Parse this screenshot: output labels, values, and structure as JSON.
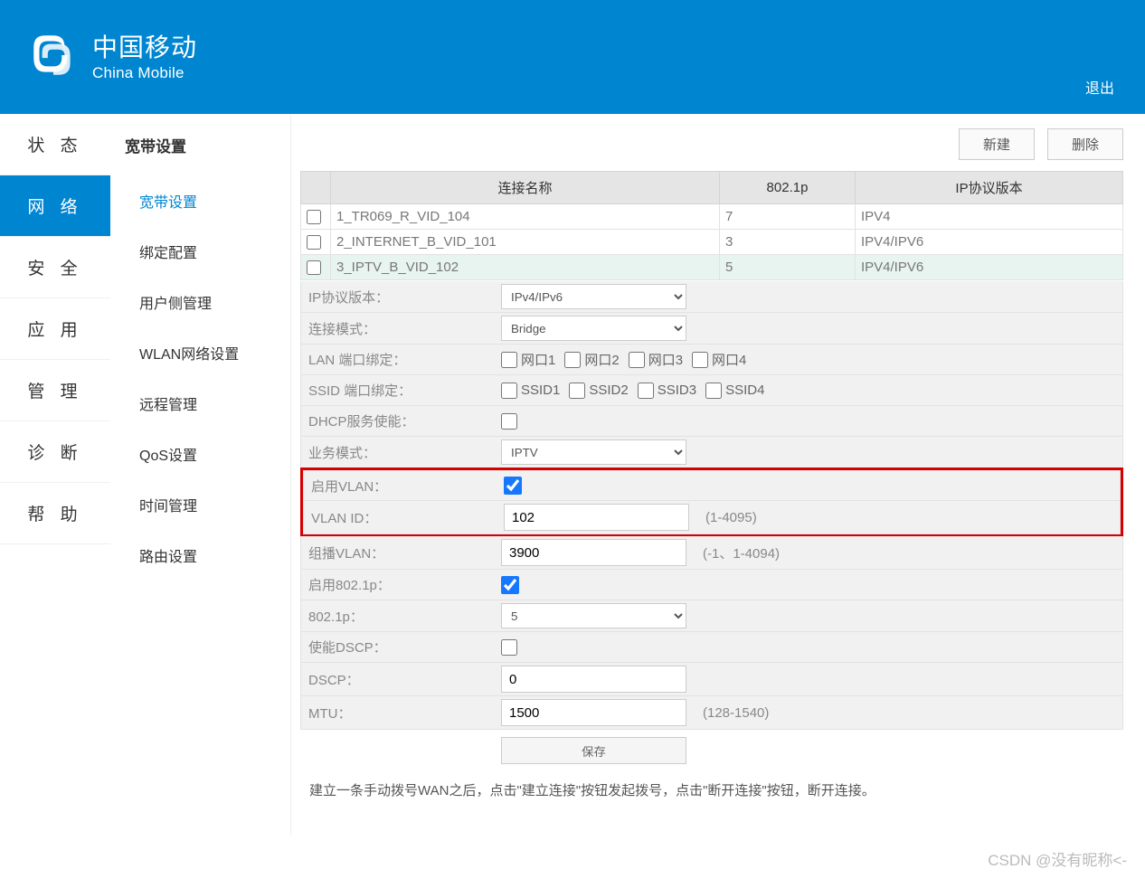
{
  "header": {
    "brand_cn": "中国移动",
    "brand_en": "China Mobile",
    "logout": "退出"
  },
  "nav1": [
    "状  态",
    "网  络",
    "安  全",
    "应  用",
    "管  理",
    "诊  断",
    "帮  助"
  ],
  "nav1_active": 1,
  "nav2_title": "宽带设置",
  "nav2": [
    "宽带设置",
    "绑定配置",
    "用户侧管理",
    "WLAN网络设置",
    "远程管理",
    "QoS设置",
    "时间管理",
    "路由设置"
  ],
  "nav2_active": 0,
  "buttons": {
    "new": "新建",
    "del": "删除",
    "save": "保存"
  },
  "table": {
    "headers": [
      "连接名称",
      "802.1p",
      "IP协议版本"
    ],
    "rows": [
      {
        "name": "1_TR069_R_VID_104",
        "p": "7",
        "ip": "IPV4",
        "sel": false
      },
      {
        "name": "2_INTERNET_B_VID_101",
        "p": "3",
        "ip": "IPV4/IPV6",
        "sel": false
      },
      {
        "name": "3_IPTV_B_VID_102",
        "p": "5",
        "ip": "IPV4/IPV6",
        "sel": true
      }
    ]
  },
  "form": {
    "ip_proto": {
      "label": "IP协议版本：",
      "value": "IPv4/IPv6"
    },
    "conn_mode": {
      "label": "连接模式：",
      "value": "Bridge"
    },
    "lan_bind": {
      "label": "LAN 端口绑定：",
      "opts": [
        "网口1",
        "网口2",
        "网口3",
        "网口4"
      ]
    },
    "ssid_bind": {
      "label": "SSID 端口绑定：",
      "opts": [
        "SSID1",
        "SSID2",
        "SSID3",
        "SSID4"
      ]
    },
    "dhcp": {
      "label": "DHCP服务使能："
    },
    "biz_mode": {
      "label": "业务模式：",
      "value": "IPTV"
    },
    "vlan_en": {
      "label": "启用VLAN："
    },
    "vlan_id": {
      "label": "VLAN ID：",
      "value": "102",
      "hint": "(1-4095)"
    },
    "mcast": {
      "label": "组播VLAN：",
      "value": "3900",
      "hint": "(-1、1-4094)"
    },
    "en8021p": {
      "label": "启用802.1p："
    },
    "p8021": {
      "label": "802.1p：",
      "value": "5"
    },
    "dscp_en": {
      "label": "使能DSCP："
    },
    "dscp": {
      "label": "DSCP：",
      "value": "0"
    },
    "mtu": {
      "label": "MTU：",
      "value": "1500",
      "hint": "(128-1540)"
    }
  },
  "note": "建立一条手动拨号WAN之后，点击\"建立连接\"按钮发起拨号，点击\"断开连接\"按钮，断开连接。",
  "watermark": "CSDN @没有昵称<-"
}
